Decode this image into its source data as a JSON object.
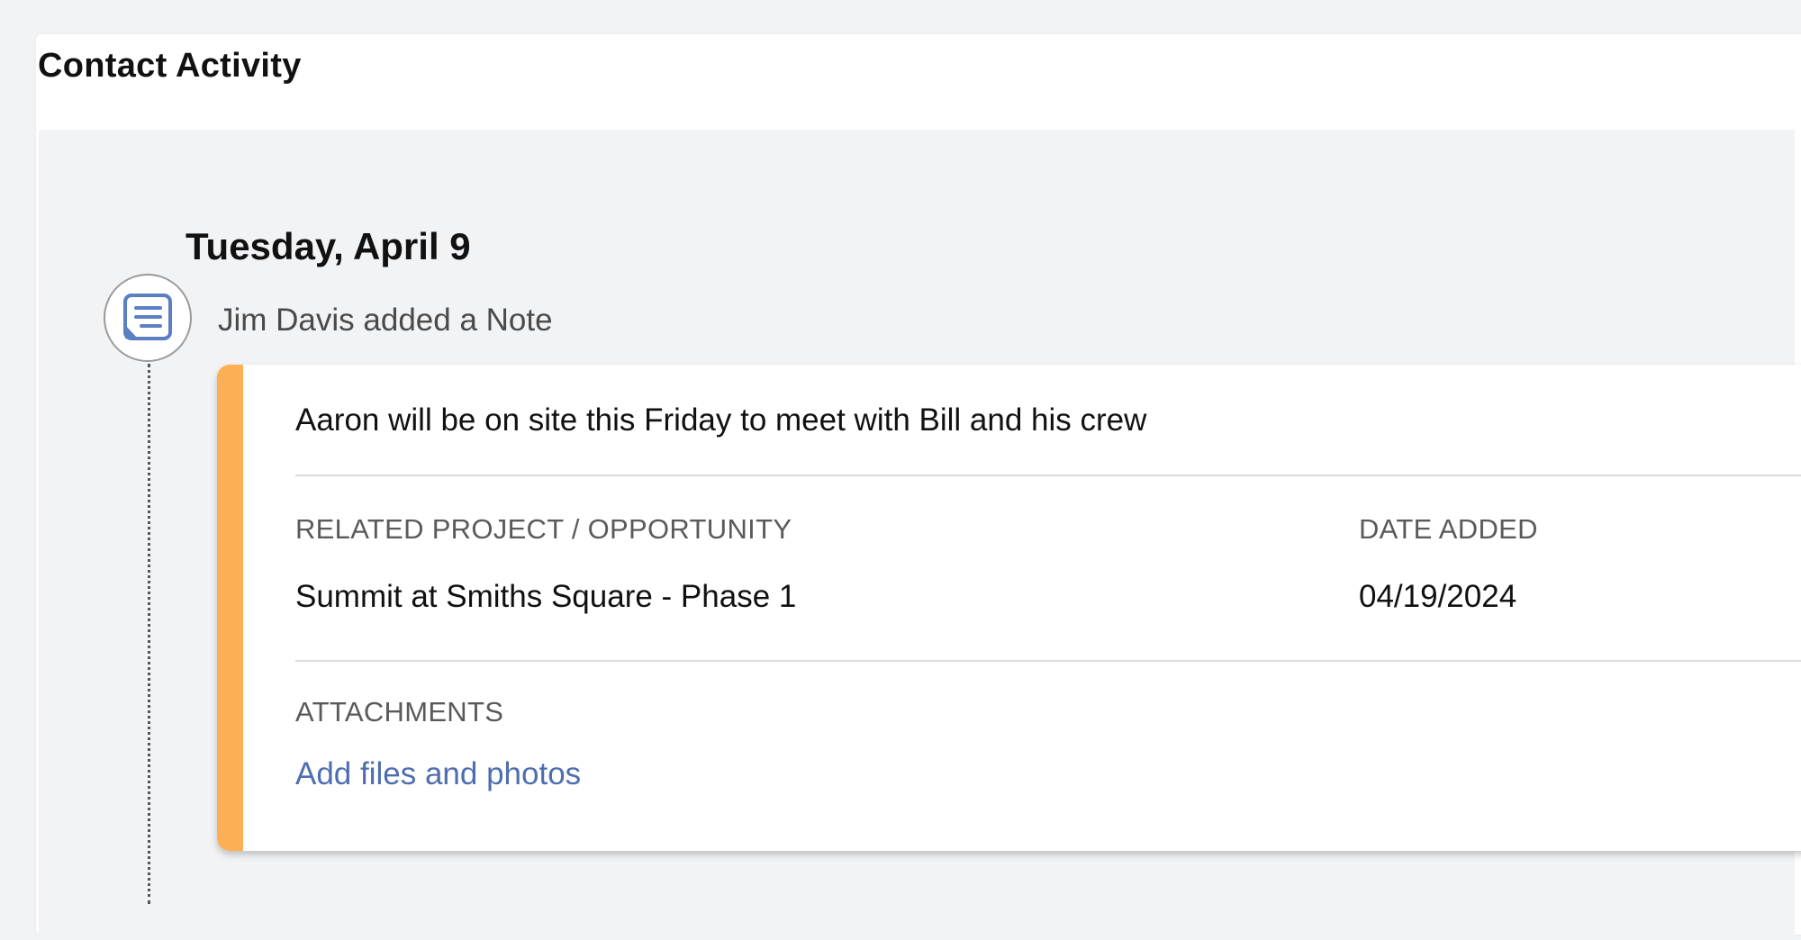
{
  "panel": {
    "title": "Contact Activity"
  },
  "timeline": {
    "day_heading": "Tuesday, April 9",
    "entry": {
      "icon": "note-icon",
      "activity_text": "Jim Davis added a Note",
      "accent_color": "#fdaf56",
      "note_text": "Aaron will be on site this Friday to meet with Bill and his crew",
      "related_project_label": "RELATED PROJECT / OPPORTUNITY",
      "related_project_value": "Summit at Smiths Square - Phase 1",
      "date_added_label": "DATE ADDED",
      "date_added_value": "04/19/2024",
      "attachments_label": "ATTACHMENTS",
      "attachments_link": "Add files and photos"
    }
  },
  "colors": {
    "link": "#4e6eaf",
    "icon": "#5b7fc4"
  }
}
